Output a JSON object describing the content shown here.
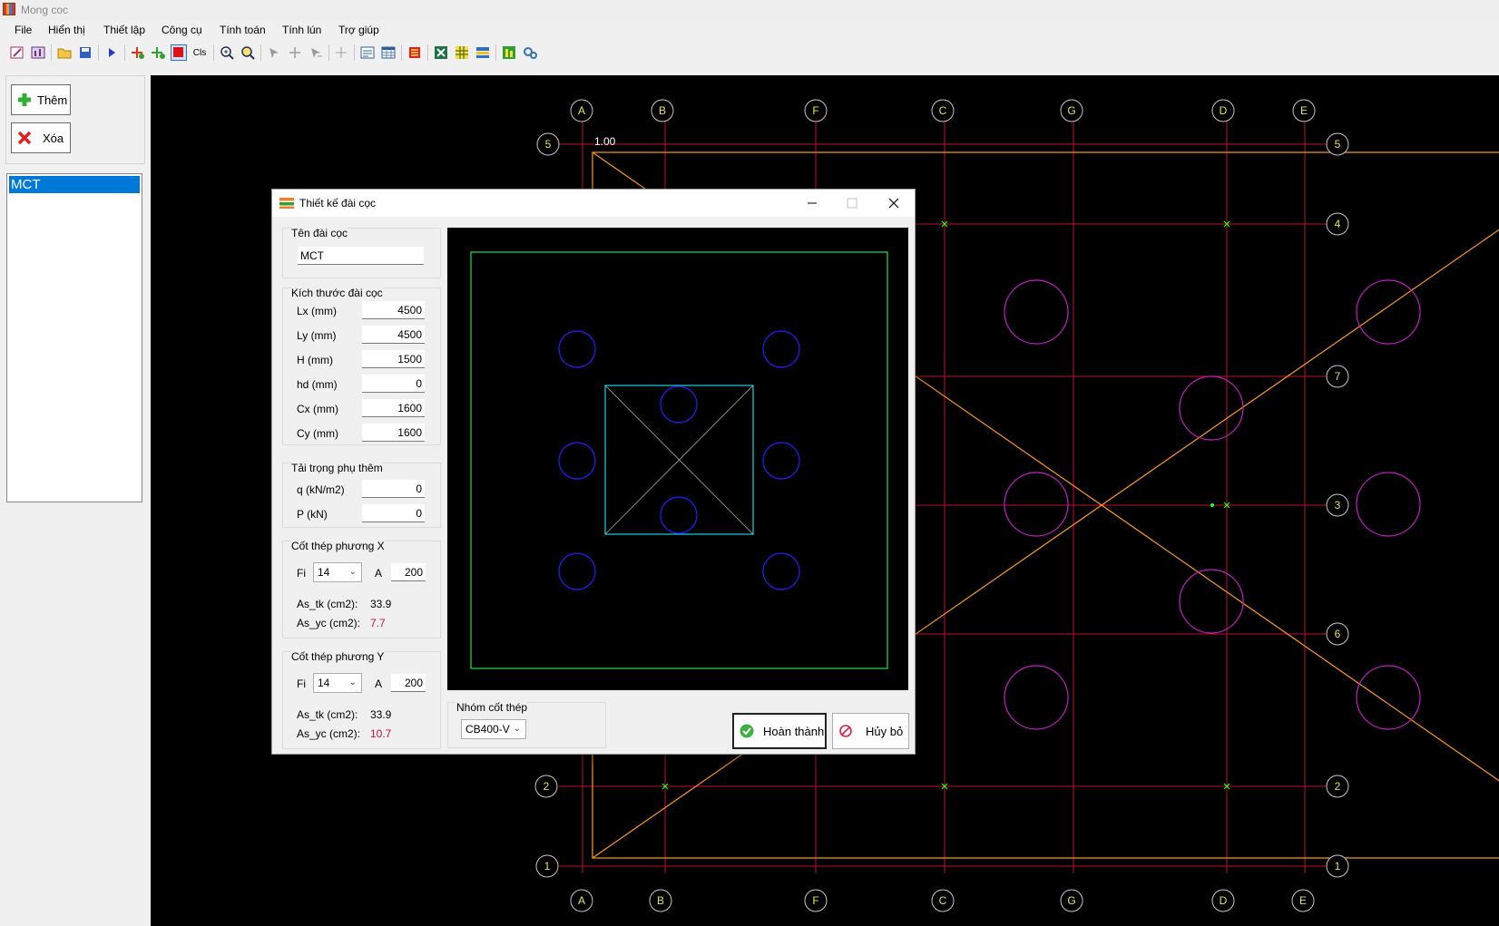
{
  "window": {
    "title": "Mong coc"
  },
  "menu": [
    "File",
    "Hiển thị",
    "Thiết lập",
    "Công cụ",
    "Tính toán",
    "Tính lún",
    "Trợ giúp"
  ],
  "toolbar": {
    "cls_label": "Cls"
  },
  "left_panel": {
    "add_label": "Thêm",
    "delete_label": "Xóa",
    "list_items": [
      "MCT"
    ]
  },
  "plan": {
    "scale_label": "1.00",
    "top_axes": [
      "A",
      "B",
      "F",
      "C",
      "G",
      "D",
      "E"
    ],
    "bottom_axes": [
      "A",
      "B",
      "F",
      "C",
      "G",
      "D",
      "E"
    ],
    "left_axes": [
      "5",
      "2",
      "1"
    ],
    "right_axes": [
      "5",
      "4",
      "7",
      "3",
      "6",
      "2",
      "1"
    ],
    "colors": {
      "grid": "#c0102a",
      "axis_bubble": "#e6e64a",
      "cap": "#ff9a1a",
      "pile": "#c020c0",
      "node": "#20ff20"
    }
  },
  "dialog": {
    "title": "Thiết kế đài cọc",
    "name_group": {
      "title": "Tên đài cọc",
      "value": "MCT"
    },
    "size_group": {
      "title": "Kích thước đài cọc",
      "fields": [
        {
          "label": "Lx (mm)",
          "value": "4500"
        },
        {
          "label": "Ly (mm)",
          "value": "4500"
        },
        {
          "label": "H (mm)",
          "value": "1500"
        },
        {
          "label": "hd (mm)",
          "value": "0"
        },
        {
          "label": "Cx (mm)",
          "value": "1600"
        },
        {
          "label": "Cy (mm)",
          "value": "1600"
        }
      ]
    },
    "load_group": {
      "title": "Tải trọng phụ thêm",
      "fields": [
        {
          "label": "q (kN/m2)",
          "value": "0"
        },
        {
          "label": "P (kN)",
          "value": "0"
        }
      ]
    },
    "steel_x": {
      "title": "Cốt thép phương X",
      "fi_label": "Fi",
      "fi_value": "14",
      "a_label": "A",
      "a_value": "200",
      "as_tk_label": "As_tk (cm2):",
      "as_tk_value": "33.9",
      "as_yc_label": "As_yc (cm2):",
      "as_yc_value": "7.7"
    },
    "steel_y": {
      "title": "Cốt thép phương Y",
      "fi_label": "Fi",
      "fi_value": "14",
      "a_label": "A",
      "a_value": "200",
      "as_tk_label": "As_tk (cm2):",
      "as_tk_value": "33.9",
      "as_yc_label": "As_yc (cm2):",
      "as_yc_value": "10.7"
    },
    "steel_group": {
      "title": "Nhóm cốt thép",
      "value": "CB400-V"
    },
    "ok_label": "Hoàn thành",
    "cancel_label": "Hủy bỏ",
    "colors": {
      "outline": "#20e050",
      "column": "#20d0e0",
      "pile": "#2020ff",
      "diag": "#b0b0b0"
    }
  }
}
